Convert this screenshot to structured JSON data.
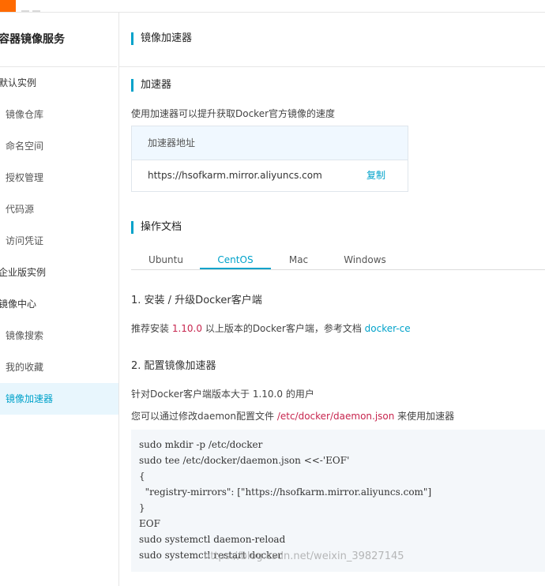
{
  "sidebar": {
    "title": "容器镜像服务",
    "items": [
      {
        "label": "默认实例",
        "type": "group"
      },
      {
        "label": "镜像仓库",
        "type": "item"
      },
      {
        "label": "命名空间",
        "type": "item"
      },
      {
        "label": "授权管理",
        "type": "item"
      },
      {
        "label": "代码源",
        "type": "item"
      },
      {
        "label": "访问凭证",
        "type": "item"
      },
      {
        "label": "企业版实例",
        "type": "group"
      },
      {
        "label": "镜像中心",
        "type": "group"
      },
      {
        "label": "镜像搜索",
        "type": "item"
      },
      {
        "label": "我的收藏",
        "type": "item"
      },
      {
        "label": "镜像加速器",
        "type": "item",
        "active": true
      }
    ]
  },
  "main": {
    "page_title": "镜像加速器",
    "accelerator": {
      "section_title": "加速器",
      "description": "使用加速器可以提升获取Docker官方镜像的速度",
      "table_header": "加速器地址",
      "url": "https://hsofkarm.mirror.aliyuncs.com",
      "copy_label": "复制"
    },
    "docs": {
      "section_title": "操作文档",
      "tabs": [
        {
          "label": "Ubuntu",
          "active": false
        },
        {
          "label": "CentOS",
          "active": true
        },
        {
          "label": "Mac",
          "active": false
        },
        {
          "label": "Windows",
          "active": false
        }
      ],
      "step1_title": "1. 安装 / 升级Docker客户端",
      "step1_text_prefix": "推荐安装 ",
      "step1_version": "1.10.0",
      "step1_text_middle": " 以上版本的Docker客户端，参考文档 ",
      "step1_link": "docker-ce",
      "step2_title": "2. 配置镜像加速器",
      "step2_text1": "针对Docker客户端版本大于 1.10.0 的用户",
      "step2_text2_prefix": "您可以通过修改daemon配置文件 ",
      "step2_path": "/etc/docker/daemon.json",
      "step2_text2_suffix": " 来使用加速器",
      "code_lines": [
        "sudo mkdir -p /etc/docker",
        "sudo tee /etc/docker/daemon.json <<-'EOF'",
        "{",
        "  \"registry-mirrors\": [\"https://hsofkarm.mirror.aliyuncs.com\"]",
        "}",
        "EOF",
        "sudo systemctl daemon-reload",
        "sudo systemctl restart docker"
      ]
    }
  },
  "watermark": "https://blog.csdn.net/weixin_39827145",
  "colors": {
    "accent": "#00a2ca",
    "brand": "#ff6a00",
    "highlight": "#c7254e"
  }
}
